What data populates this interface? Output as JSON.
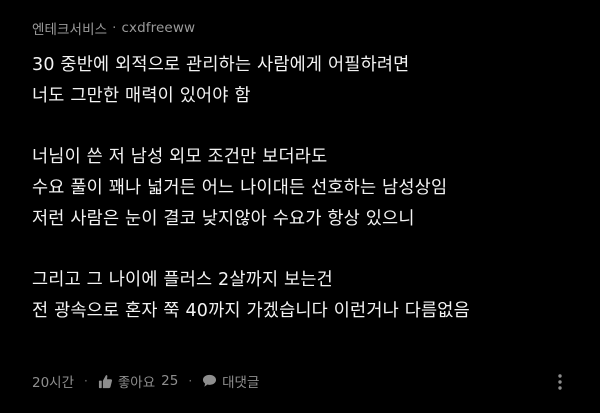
{
  "comment": {
    "author": {
      "company": "엔테크서비스",
      "separator": "·",
      "nickname": "cxdfreeww"
    },
    "paragraphs": [
      {
        "lines": [
          "30 중반에 외적으로 관리하는 사람에게 어필하려면",
          "너도 그만한 매력이 있어야 함"
        ]
      },
      {
        "lines": [
          "너님이 쓴 저 남성 외모 조건만 보더라도",
          "수요 풀이 꽤나 넓거든 어느 나이대든 선호하는 남성상임",
          "저런 사람은 눈이 결코 낮지않아 수요가 항상 있으니"
        ]
      },
      {
        "lines": [
          "그리고 그 나이에 플러스 2살까지 보는건",
          "전 광속으로 혼자 쭉 40까지 가겠습니다 이런거나 다름없음"
        ]
      }
    ],
    "footer": {
      "time": "20시간",
      "dot": "·",
      "like_label": "좋아요",
      "like_count": "25",
      "reply_label": "대댓글"
    },
    "icons": {
      "like": "thumbs-up-icon",
      "reply": "speech-bubble-icon",
      "more": "more-vertical-icon"
    },
    "colors": {
      "background": "#000000",
      "text": "#f4f4f4",
      "meta": "#9a9a9a"
    }
  }
}
